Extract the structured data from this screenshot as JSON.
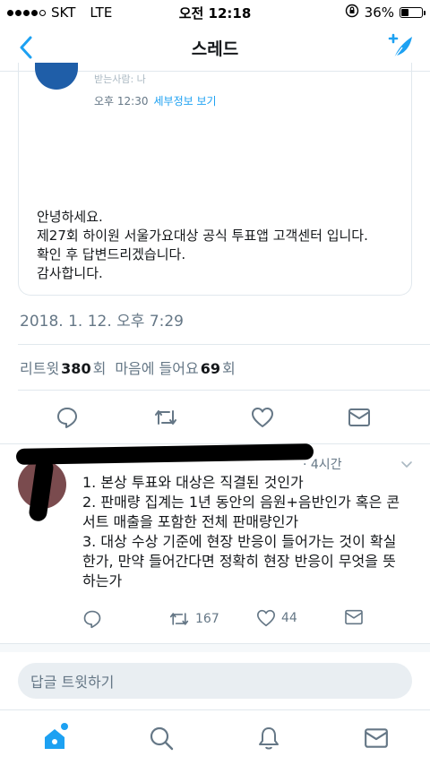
{
  "status_bar": {
    "carrier": "SKT",
    "network": "LTE",
    "time": "오전 12:18",
    "battery": "36%",
    "battery_level": 0.36
  },
  "nav": {
    "title": "스레드"
  },
  "quoted_card": {
    "recipient": "받는사람: 나",
    "time": "오후 12:30",
    "details_link": "세부정보 보기",
    "lines": [
      "안녕하세요.",
      "제27회 하이원 서울가요대상 공식 투표앱 고객센터 입니다.",
      "확인 후 답변드리겠습니다.",
      "감사합니다."
    ]
  },
  "tweet": {
    "date": "2018. 1. 12. 오후 7:29",
    "retweet_label": "리트윗",
    "retweet_count": "380",
    "retweet_unit": "회",
    "like_label": "마음에 들어요",
    "like_count": "69",
    "like_unit": "회"
  },
  "reply": {
    "time": "· 4시간",
    "lines": [
      "1. 본상 투표와 대상은 직결된 것인가",
      "2. 판매량 집계는 1년 동안의 음원+음반인가 혹은 콘",
      "서트 매출을 포함한 전체 판매량인가",
      "3. 대상 수상 기준에 현장 반응이 들어가는 것이 확실",
      "한가, 만약 들어간다면 정확히 현장 반응이 무엇을 뜻",
      "하는가"
    ],
    "retweets": "167",
    "likes": "44"
  },
  "reply_input": {
    "placeholder": "답글 트윗하기"
  },
  "colors": {
    "accent": "#1da1f2",
    "text": "#14171a",
    "muted": "#657786"
  }
}
